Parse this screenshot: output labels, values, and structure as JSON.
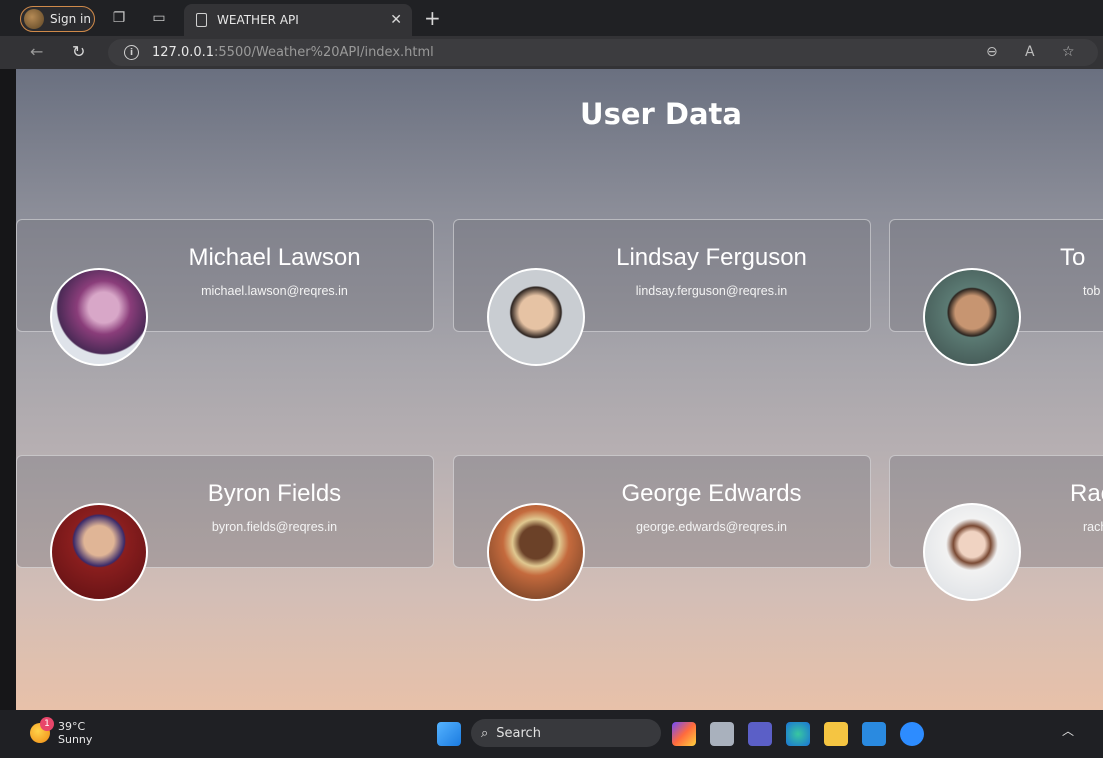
{
  "browser": {
    "signin_label": "Sign in",
    "tab_title": "WEATHER API",
    "url_host": "127.0.0.1",
    "url_path": ":5500/Weather%20API/index.html"
  },
  "page": {
    "title": "User Data",
    "users": [
      {
        "name": "Michael Lawson",
        "email": "michael.lawson@reqres.in"
      },
      {
        "name": "Lindsay Ferguson",
        "email": "lindsay.ferguson@reqres.in"
      },
      {
        "name": "To",
        "email": "tob"
      },
      {
        "name": "Byron Fields",
        "email": "byron.fields@reqres.in"
      },
      {
        "name": "George Edwards",
        "email": "george.edwards@reqres.in"
      },
      {
        "name": "Rac",
        "email": "rach"
      }
    ]
  },
  "taskbar": {
    "temperature": "39°C",
    "condition": "Sunny",
    "notification_count": "1",
    "search_label": "Search"
  }
}
